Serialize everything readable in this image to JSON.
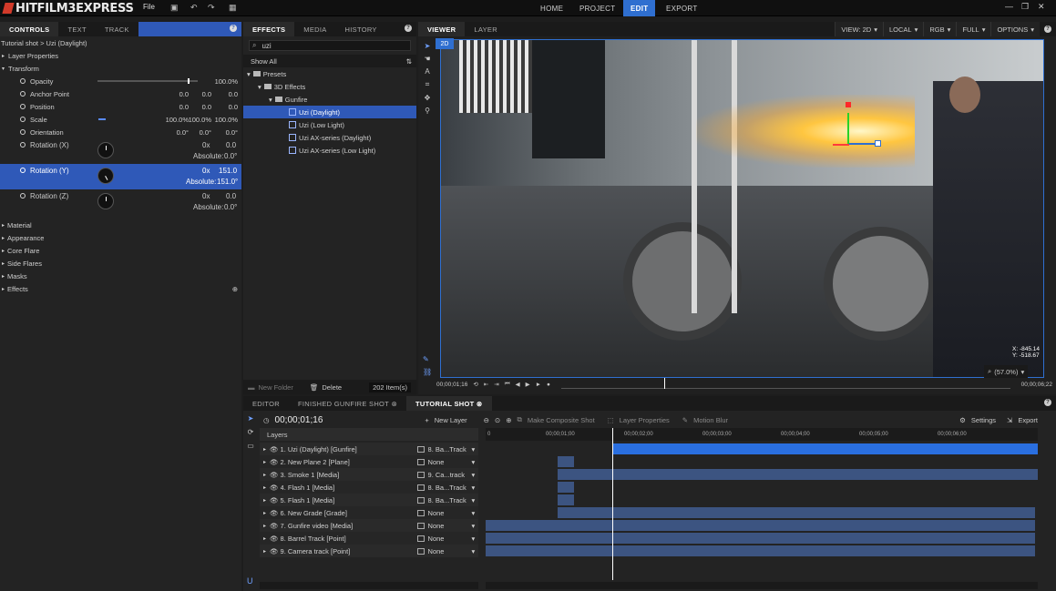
{
  "app": {
    "logo": "HITFILM3EXPRESS",
    "menu_file": "File"
  },
  "nav": {
    "tabs": [
      {
        "label": "HOME"
      },
      {
        "label": "PROJECT"
      },
      {
        "label": "EDIT"
      },
      {
        "label": "EXPORT"
      }
    ],
    "active": "EDIT"
  },
  "controls": {
    "tabs": [
      "CONTROLS",
      "TEXT",
      "TRACK"
    ],
    "shot_title": "Tutorial shot > Uzi (Daylight)",
    "layer_properties": "Layer Properties",
    "transform": "Transform",
    "rows": [
      {
        "label": "Opacity",
        "v1": "",
        "v2": "",
        "v3": "100.0%",
        "slider": 0.9
      },
      {
        "label": "Anchor Point",
        "v1": "0.0",
        "v2": "0.0",
        "v3": "0.0"
      },
      {
        "label": "Position",
        "v1": "0.0",
        "v2": "0.0",
        "v3": "0.0"
      },
      {
        "label": "Scale",
        "v1": "100.0%",
        "v2": "100.0%",
        "v3": "100.0%"
      },
      {
        "label": "Orientation",
        "v1": "0.0°",
        "v2": "0.0°",
        "v3": "0.0°"
      }
    ],
    "rotation_x": {
      "label": "Rotation (X)",
      "turns": "0x",
      "value": "0.0",
      "absolute_label": "Absolute:",
      "absolute": "0.0°"
    },
    "rotation_y": {
      "label": "Rotation (Y)",
      "turns": "0x",
      "value": "151.0",
      "absolute_label": "Absolute:",
      "absolute": "151.0°"
    },
    "rotation_z": {
      "label": "Rotation (Z)",
      "turns": "0x",
      "value": "0.0",
      "absolute_label": "Absolute:",
      "absolute": "0.0°"
    },
    "sections": [
      "Material",
      "Appearance",
      "Core Flare",
      "Side Flares",
      "Masks",
      "Effects"
    ]
  },
  "effects": {
    "tabs": [
      "EFFECTS",
      "MEDIA",
      "HISTORY"
    ],
    "search_value": "uzi",
    "show_all": "Show All",
    "tree": [
      "Presets",
      "3D Effects",
      "Gunfire"
    ],
    "items": [
      "Uzi (Daylight)",
      "Uzi (Low Light)",
      "Uzi AX-series (Daylight)",
      "Uzi AX-series (Low Light)"
    ],
    "footer": {
      "new_folder": "New Folder",
      "delete": "Delete",
      "count": "202 Item(s)"
    }
  },
  "viewer": {
    "tabs": [
      "VIEWER",
      "LAYER"
    ],
    "mode_badge": "2D",
    "options": [
      "VIEW: 2D",
      "LOCAL",
      "RGB",
      "FULL",
      "OPTIONS"
    ],
    "coords": {
      "x": "X: -845.14",
      "y": "Y: -518.67"
    },
    "zoom": "(57.0%)",
    "time_current": "00;00;01;16",
    "time_end": "00;00;06;22",
    "playhead": 0.23
  },
  "timeline": {
    "tabs": [
      "EDITOR",
      "FINISHED GUNFIRE SHOT",
      "TUTORIAL SHOT"
    ],
    "timecode": "00;00;01;16",
    "new_layer": "New Layer",
    "make_composite": "Make Composite Shot",
    "layer_properties": "Layer Properties",
    "motion_blur": "Motion Blur",
    "settings": "Settings",
    "export": "Export",
    "layers_header": "Layers",
    "ruler": [
      "0",
      "00;00;01;00",
      "00;00;02;00",
      "00;00;03;00",
      "00;00;04;00",
      "00;00;05;00",
      "00;00;06;00"
    ],
    "layers": [
      {
        "name": "1. Uzi (Daylight) [Gunfire]",
        "parent": "8. Ba...Track",
        "start": 0.23,
        "end": 1.0,
        "active": true
      },
      {
        "name": "2. New Plane 2 [Plane]",
        "parent": "None",
        "start": 0.13,
        "end": 0.16
      },
      {
        "name": "3. Smoke 1 [Media]",
        "parent": "9. Ca...track",
        "start": 0.13,
        "end": 1.0
      },
      {
        "name": "4. Flash 1 [Media]",
        "parent": "8. Ba...Track",
        "start": 0.13,
        "end": 0.16
      },
      {
        "name": "5. Flash 1 [Media]",
        "parent": "8. Ba...Track",
        "start": 0.13,
        "end": 0.16
      },
      {
        "name": "6. New Grade [Grade]",
        "parent": "None",
        "start": 0.13,
        "end": 0.995
      },
      {
        "name": "7. Gunfire video [Media]",
        "parent": "None",
        "start": 0.0,
        "end": 0.995
      },
      {
        "name": "8. Barrel Track [Point]",
        "parent": "None",
        "start": 0.0,
        "end": 0.995
      },
      {
        "name": "9. Camera track [Point]",
        "parent": "None",
        "start": 0.0,
        "end": 0.995
      }
    ],
    "playhead": 0.23
  }
}
